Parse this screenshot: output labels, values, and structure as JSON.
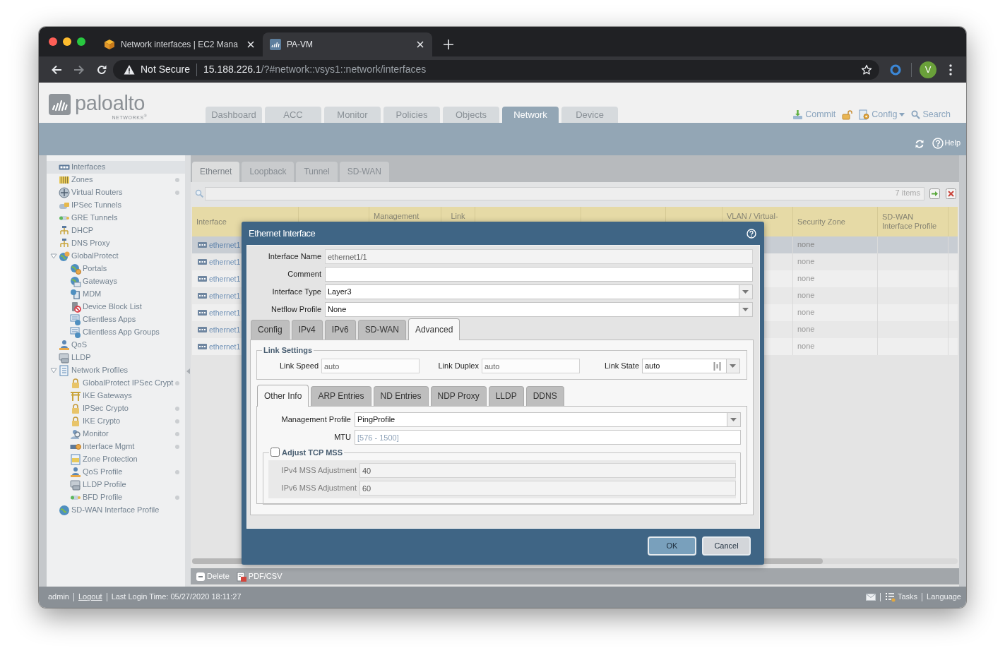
{
  "browser": {
    "tabs": [
      {
        "title": "Network interfaces | EC2 Mana",
        "selected": false
      },
      {
        "title": "PA-VM",
        "selected": true
      }
    ],
    "address_bar": {
      "security": "Not Secure",
      "host": "15.188.226.1",
      "path": "/?#network::vsys1::network/interfaces"
    },
    "profile_initial": "V"
  },
  "header": {
    "logo": {
      "wordmark": "paloalto",
      "tagline": "NETWORKS$^{®}$"
    },
    "nav_tabs": [
      {
        "label": "Dashboard",
        "selected": false
      },
      {
        "label": "ACC",
        "selected": false
      },
      {
        "label": "Monitor",
        "selected": false
      },
      {
        "label": "Policies",
        "selected": false
      },
      {
        "label": "Objects",
        "selected": false
      },
      {
        "label": "Network",
        "selected": true
      },
      {
        "label": "Device",
        "selected": false
      }
    ],
    "commit": "Commit",
    "config": "Config",
    "search": "Search",
    "help": "Help"
  },
  "sidebar": {
    "items": [
      {
        "label": "Interfaces",
        "selected": true,
        "indicator": false
      },
      {
        "label": "Zones",
        "selected": false,
        "indicator": true
      },
      {
        "label": "Virtual Routers",
        "selected": false,
        "indicator": true
      },
      {
        "label": "IPSec Tunnels",
        "selected": false,
        "indicator": false
      },
      {
        "label": "GRE Tunnels",
        "selected": false,
        "indicator": false
      },
      {
        "label": "DHCP",
        "selected": false,
        "indicator": false
      },
      {
        "label": "DNS Proxy",
        "selected": false,
        "indicator": false
      },
      {
        "label": "GlobalProtect",
        "selected": false,
        "indicator": false,
        "expanded": true,
        "children": [
          {
            "label": "Portals",
            "selected": false,
            "indicator": false
          },
          {
            "label": "Gateways",
            "selected": false,
            "indicator": false
          },
          {
            "label": "MDM",
            "selected": false,
            "indicator": false
          },
          {
            "label": "Device Block List",
            "selected": false,
            "indicator": false
          },
          {
            "label": "Clientless Apps",
            "selected": false,
            "indicator": false
          },
          {
            "label": "Clientless App Groups",
            "selected": false,
            "indicator": false
          }
        ]
      },
      {
        "label": "QoS",
        "selected": false,
        "indicator": false
      },
      {
        "label": "LLDP",
        "selected": false,
        "indicator": false
      },
      {
        "label": "Network Profiles",
        "selected": false,
        "indicator": false,
        "expanded": true,
        "children": [
          {
            "label": "GlobalProtect IPSec Crypt",
            "selected": false,
            "indicator": true
          },
          {
            "label": "IKE Gateways",
            "selected": false,
            "indicator": false
          },
          {
            "label": "IPSec Crypto",
            "selected": false,
            "indicator": true
          },
          {
            "label": "IKE Crypto",
            "selected": false,
            "indicator": true
          },
          {
            "label": "Monitor",
            "selected": false,
            "indicator": true
          },
          {
            "label": "Interface Mgmt",
            "selected": false,
            "indicator": true
          },
          {
            "label": "Zone Protection",
            "selected": false,
            "indicator": false
          },
          {
            "label": "QoS Profile",
            "selected": false,
            "indicator": true
          },
          {
            "label": "LLDP Profile",
            "selected": false,
            "indicator": false
          },
          {
            "label": "BFD Profile",
            "selected": false,
            "indicator": true
          }
        ]
      },
      {
        "label": "SD-WAN Interface Profile",
        "selected": false,
        "indicator": false
      }
    ]
  },
  "interface_tabs": [
    {
      "label": "Ethernet",
      "selected": true
    },
    {
      "label": "Loopback",
      "selected": false
    },
    {
      "label": "Tunnel",
      "selected": false
    },
    {
      "label": "SD-WAN",
      "selected": false
    }
  ],
  "filter": {
    "count": "7 items"
  },
  "table": {
    "columns": [
      "Interface",
      "Management",
      "Link",
      "VLAN / Virtual-",
      "Security Zone",
      "SD-WAN Interface Profile"
    ],
    "rows": [
      {
        "interface": "ethernet1",
        "security_zone": "none",
        "selected": true
      },
      {
        "interface": "ethernet1",
        "security_zone": "none",
        "selected": false
      },
      {
        "interface": "ethernet1",
        "security_zone": "none",
        "selected": false
      },
      {
        "interface": "ethernet1",
        "security_zone": "none",
        "selected": false
      },
      {
        "interface": "ethernet1",
        "security_zone": "none",
        "selected": false
      },
      {
        "interface": "ethernet1",
        "security_zone": "none",
        "selected": false
      },
      {
        "interface": "ethernet1",
        "security_zone": "none",
        "selected": false
      }
    ]
  },
  "actions": [
    "Delete",
    "PDF/CSV"
  ],
  "status_bar": {
    "user": "admin",
    "logout": "Logout",
    "last_login": "Last Login Time: 05/27/2020 18:11:27",
    "tasks": "Tasks",
    "language": "Language"
  },
  "dialog": {
    "title": "Ethernet Interface",
    "fields": [
      {
        "label": "Interface Name",
        "kind": "text",
        "value": "ethernet1/1",
        "disabled": true
      },
      {
        "label": "Comment",
        "kind": "text",
        "disabled": false
      },
      {
        "label": "Interface Type",
        "kind": "select",
        "value": "Layer3",
        "disabled": false
      },
      {
        "label": "Netflow Profile",
        "kind": "select",
        "value": "None",
        "disabled": false
      }
    ],
    "tabs": [
      {
        "label": "Config",
        "selected": false
      },
      {
        "label": "IPv4",
        "selected": false
      },
      {
        "label": "IPv6",
        "selected": false
      },
      {
        "label": "SD-WAN",
        "selected": false
      },
      {
        "label": "Advanced",
        "selected": true
      }
    ],
    "link_settings": {
      "title": "Link Settings",
      "fields": [
        {
          "label": "Link Speed",
          "kind": "text",
          "value": "auto",
          "disabled": true
        },
        {
          "label": "Link Duplex",
          "kind": "text",
          "value": "auto",
          "disabled": true
        },
        {
          "label": "Link State",
          "kind": "combo",
          "value": "auto",
          "disabled": false
        }
      ]
    },
    "subtabs": [
      {
        "label": "Other Info",
        "selected": true
      },
      {
        "label": "ARP Entries",
        "selected": false
      },
      {
        "label": "ND Entries",
        "selected": false
      },
      {
        "label": "NDP Proxy",
        "selected": false
      },
      {
        "label": "LLDP",
        "selected": false
      },
      {
        "label": "DDNS",
        "selected": false
      }
    ],
    "other_info": {
      "fields": [
        {
          "label": "Management Profile",
          "kind": "select",
          "value": "PingProfile",
          "disabled": false
        },
        {
          "label": "MTU",
          "kind": "text",
          "placeholder": "[576 - 1500]",
          "disabled": false
        }
      ],
      "adjust_tcp_mss": {
        "label": "Adjust TCP MSS",
        "checked": false,
        "fields": [
          {
            "label": "IPv4 MSS Adjustment",
            "value": "40"
          },
          {
            "label": "IPv6 MSS Adjustment",
            "value": "60"
          }
        ]
      }
    },
    "buttons": [
      {
        "label": "OK",
        "kind": "primary"
      },
      {
        "label": "Cancel",
        "kind": "secondary"
      }
    ]
  }
}
